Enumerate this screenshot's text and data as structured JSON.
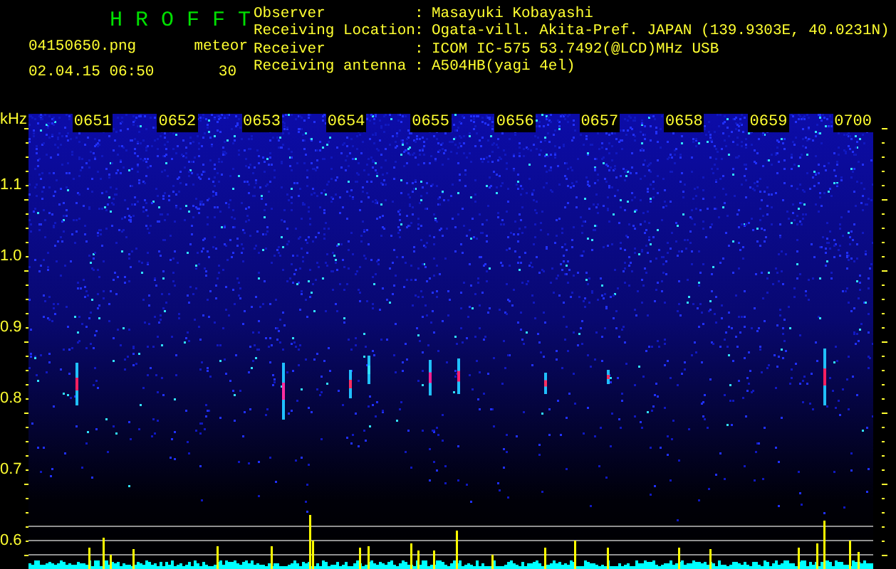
{
  "app": {
    "title": "H R O F F T",
    "file": "04150650.png",
    "timestamp": "02.04.15 06:50",
    "meteor_label": "meteor",
    "meteor_count": "30"
  },
  "station": [
    {
      "label": "Observer",
      "value": "Masayuki Kobayashi"
    },
    {
      "label": "Receiving Location",
      "value": "Ogata-vill. Akita-Pref. JAPAN (139.9303E, 40.0231N)"
    },
    {
      "label": "Receiver",
      "value": "ICOM IC-575 53.7492(@LCD)MHz USB"
    },
    {
      "label": "Receiving antenna",
      "value": "A504HB(yagi 4el)"
    }
  ],
  "separator": ":",
  "plot": {
    "unit": "kHz",
    "y_labels": [
      "1.1",
      "1.0",
      "0.9",
      "0.8",
      "0.7",
      "0.6"
    ],
    "time_labels": [
      "0651",
      "0652",
      "0653",
      "0654",
      "0655",
      "0656",
      "0657",
      "0658",
      "0659",
      "0700"
    ]
  }
}
